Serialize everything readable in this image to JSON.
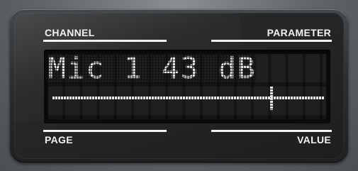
{
  "labels": {
    "channel": "CHANNEL",
    "parameter": "PARAMETER",
    "page": "PAGE",
    "value": "VALUE"
  },
  "lcd": {
    "text": "Mic 1 43 dB",
    "slider_value_fraction": 0.8
  },
  "colors": {
    "label_text": "#f2f2f2",
    "lcd_pixel": "#e9e9e9",
    "lcd_background": "#0d0d0d",
    "panel": "#222426"
  }
}
